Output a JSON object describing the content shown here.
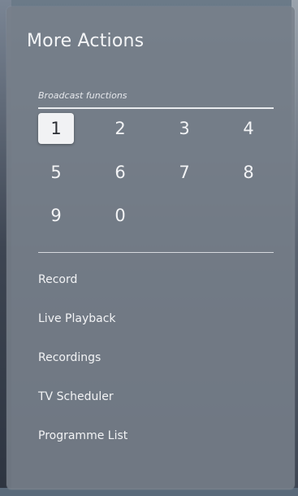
{
  "panel": {
    "title": "More Actions",
    "section_label": "Broadcast functions"
  },
  "numbers": {
    "selected": "1",
    "keys": [
      "1",
      "2",
      "3",
      "4",
      "5",
      "6",
      "7",
      "8",
      "9",
      "0"
    ]
  },
  "menu": {
    "items": [
      {
        "label": "Record"
      },
      {
        "label": "Live Playback"
      },
      {
        "label": "Recordings"
      },
      {
        "label": "TV Scheduler"
      },
      {
        "label": "Programme List"
      }
    ]
  }
}
